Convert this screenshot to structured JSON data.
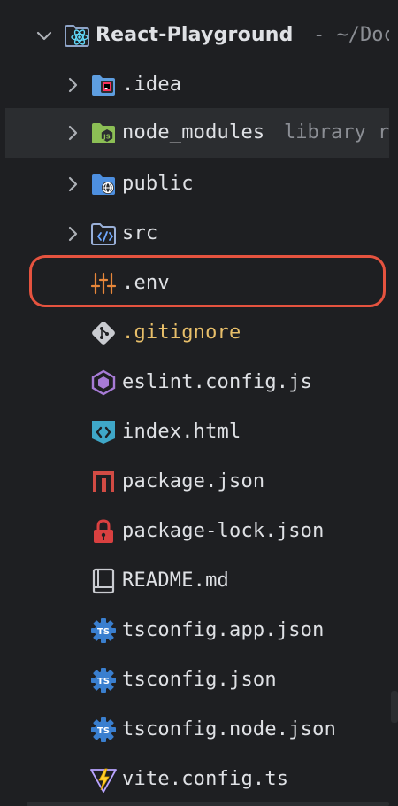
{
  "tree": {
    "root": {
      "label": "React-Playground",
      "hint": "- ~/Doc",
      "icon": "react-folder-icon"
    },
    "items": [
      {
        "label": ".idea",
        "icon": "idea-folder-icon",
        "kind": "folder"
      },
      {
        "label": "node_modules",
        "hint": "library ro",
        "icon": "node-modules-folder-icon",
        "kind": "folder"
      },
      {
        "label": "public",
        "icon": "public-folder-icon",
        "kind": "folder"
      },
      {
        "label": "src",
        "icon": "source-folder-icon",
        "kind": "folder"
      },
      {
        "label": ".env",
        "icon": "env-settings-icon",
        "kind": "file"
      },
      {
        "label": ".gitignore",
        "icon": "git-icon",
        "kind": "file"
      },
      {
        "label": "eslint.config.js",
        "icon": "eslint-icon",
        "kind": "file"
      },
      {
        "label": "index.html",
        "icon": "html-icon",
        "kind": "file"
      },
      {
        "label": "package.json",
        "icon": "npm-icon",
        "kind": "file"
      },
      {
        "label": "package-lock.json",
        "icon": "lock-icon",
        "kind": "file"
      },
      {
        "label": "README.md",
        "icon": "readme-icon",
        "kind": "file"
      },
      {
        "label": "tsconfig.app.json",
        "icon": "tsconfig-icon",
        "kind": "file"
      },
      {
        "label": "tsconfig.json",
        "icon": "tsconfig-icon",
        "kind": "file"
      },
      {
        "label": "tsconfig.node.json",
        "icon": "tsconfig-icon",
        "kind": "file"
      },
      {
        "label": "vite.config.ts",
        "icon": "vite-icon",
        "kind": "file"
      }
    ]
  },
  "colors": {
    "background": "#1e1f22",
    "hover_row": "#2b2d30",
    "text": "#dfe1e5",
    "gitignore_text": "#e8bf6a",
    "highlight_border": "#e5533f"
  }
}
